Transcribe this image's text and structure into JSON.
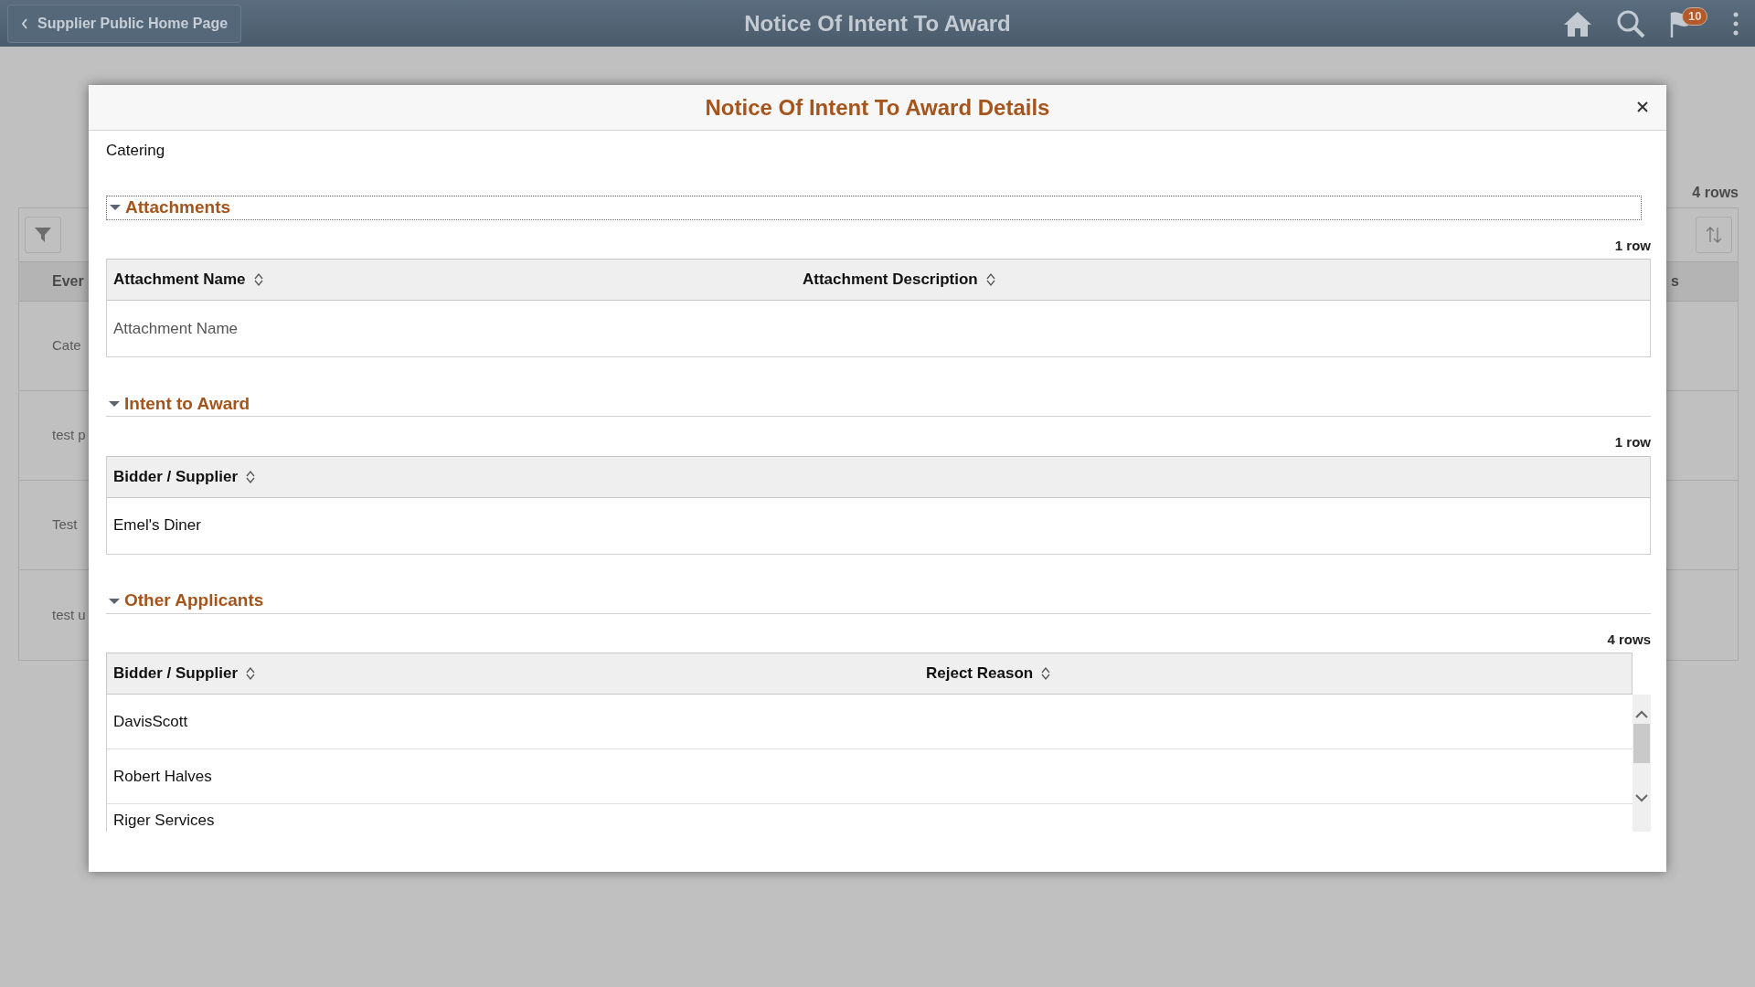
{
  "header": {
    "back_button": "Supplier Public Home Page",
    "title": "Notice Of Intent To Award",
    "notification_count": "10"
  },
  "background_grid": {
    "row_count": "4 rows",
    "columns": [
      "Ever",
      "s"
    ],
    "rows": [
      "Cate",
      "test p",
      "Test",
      "test u"
    ]
  },
  "dialog": {
    "title": "Notice Of Intent To Award Details",
    "subtitle": "Catering",
    "sections": [
      {
        "kind": "grid",
        "title": "Attachments",
        "expanded": true,
        "focused": true,
        "row_count": "1 row",
        "columns": [
          "Attachment Name",
          "Attachment Description"
        ],
        "rows": [
          "Attachment Name"
        ]
      },
      {
        "kind": "grid",
        "title": "Intent to Award",
        "expanded": true,
        "focused": false,
        "row_count": "1 row",
        "columns": [
          "Bidder / Supplier"
        ],
        "rows": [
          "Emel's Diner"
        ]
      },
      {
        "kind": "scroll",
        "title": "Other Applicants",
        "expanded": true,
        "focused": false,
        "row_count": "4 rows",
        "columns": [
          "Bidder / Supplier",
          "Reject Reason"
        ],
        "rows": [
          "DavisScott",
          "Robert Halves",
          "Riger Services"
        ]
      }
    ]
  }
}
